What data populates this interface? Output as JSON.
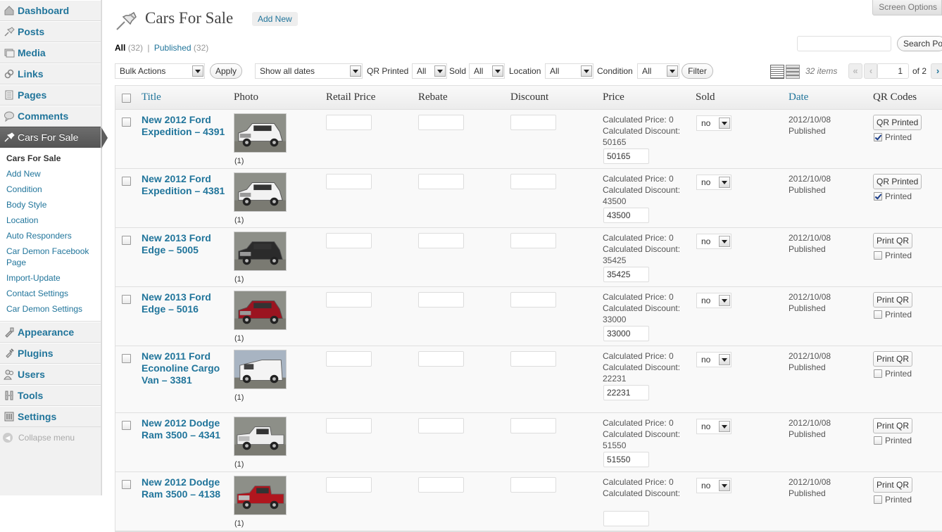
{
  "menu": {
    "items_top": [
      {
        "label": "Dashboard",
        "icon": "dashboard-icon"
      },
      {
        "label": "Posts",
        "icon": "pin-icon"
      },
      {
        "label": "Media",
        "icon": "media-icon"
      },
      {
        "label": "Links",
        "icon": "link-icon"
      },
      {
        "label": "Pages",
        "icon": "pages-icon"
      },
      {
        "label": "Comments",
        "icon": "comment-icon"
      },
      {
        "label": "Cars For Sale",
        "icon": "pin-icon"
      }
    ],
    "submenu": [
      "Cars For Sale",
      "Add New",
      "Condition",
      "Body Style",
      "Location",
      "Auto Responders",
      "Car Demon Facebook Page",
      "Import-Update",
      "Contact Settings",
      "Car Demon Settings"
    ],
    "items_bottom": [
      {
        "label": "Appearance",
        "icon": "appearance-icon"
      },
      {
        "label": "Plugins",
        "icon": "plugin-icon"
      },
      {
        "label": "Users",
        "icon": "users-icon"
      },
      {
        "label": "Tools",
        "icon": "tools-icon"
      },
      {
        "label": "Settings",
        "icon": "settings-icon"
      }
    ],
    "collapse": "Collapse menu"
  },
  "header": {
    "screen_options": "Screen Options",
    "title": "Cars For Sale",
    "add_new": "Add New",
    "search_button": "Search Po"
  },
  "views": {
    "all": "All",
    "all_count": "(32)",
    "sep": "|",
    "published": "Published",
    "published_count": "(32)"
  },
  "filters": {
    "bulk_actions": "Bulk Actions",
    "apply": "Apply",
    "dates": "Show all dates",
    "qr_label": "QR Printed",
    "qr_value": "All",
    "sold_label": "Sold",
    "sold_value": "All",
    "location_label": "Location",
    "location_value": "All",
    "condition_label": "Condition",
    "condition_value": "All",
    "filter": "Filter"
  },
  "pagination": {
    "items": "32 items",
    "first": "«",
    "prev": "‹",
    "current": "1",
    "of": "of 2",
    "next": "›"
  },
  "columns": [
    "Title",
    "Photo",
    "Retail Price",
    "Rebate",
    "Discount",
    "Price",
    "Sold",
    "Date",
    "QR Codes"
  ],
  "rows": [
    {
      "title": "New 2012 Ford Expedition – 4391",
      "count": "(1)",
      "calc_price": "Calculated Price: 0",
      "calc_discount": "Calculated Discount:",
      "discount_val": "50165",
      "price_input": "50165",
      "sold": "no",
      "date": "2012/10/08",
      "status": "Published",
      "qr_button": "QR Printed",
      "printed": "Printed",
      "printed_checked": true,
      "photo": "white-suv"
    },
    {
      "title": "New 2012 Ford Expedition – 4381",
      "count": "(1)",
      "calc_price": "Calculated Price: 0",
      "calc_discount": "Calculated Discount:",
      "discount_val": "43500",
      "price_input": "43500",
      "sold": "no",
      "date": "2012/10/08",
      "status": "Published",
      "qr_button": "QR Printed",
      "printed": "Printed",
      "printed_checked": true,
      "photo": "white-suv"
    },
    {
      "title": "New 2013 Ford Edge – 5005",
      "count": "(1)",
      "calc_price": "Calculated Price: 0",
      "calc_discount": "Calculated Discount:",
      "discount_val": "35425",
      "price_input": "35425",
      "sold": "no",
      "date": "2012/10/08",
      "status": "Published",
      "qr_button": "Print QR",
      "printed": "Printed",
      "printed_checked": false,
      "photo": "black-suv"
    },
    {
      "title": "New 2013 Ford Edge – 5016",
      "count": "(1)",
      "calc_price": "Calculated Price: 0",
      "calc_discount": "Calculated Discount:",
      "discount_val": "33000",
      "price_input": "33000",
      "sold": "no",
      "date": "2012/10/08",
      "status": "Published",
      "qr_button": "Print QR",
      "printed": "Printed",
      "printed_checked": false,
      "photo": "red-suv"
    },
    {
      "title": "New 2011 Ford Econoline Cargo Van – 3381",
      "count": "(1)",
      "calc_price": "Calculated Price: 0",
      "calc_discount": "Calculated Discount:",
      "discount_val": "22231",
      "price_input": "22231",
      "sold": "no",
      "date": "2012/10/08",
      "status": "Published",
      "qr_button": "Print QR",
      "printed": "Printed",
      "printed_checked": false,
      "photo": "white-van"
    },
    {
      "title": "New 2012 Dodge Ram 3500 – 4341",
      "count": "(1)",
      "calc_price": "Calculated Price: 0",
      "calc_discount": "Calculated Discount:",
      "discount_val": "51550",
      "price_input": "51550",
      "sold": "no",
      "date": "2012/10/08",
      "status": "Published",
      "qr_button": "Print QR",
      "printed": "Printed",
      "printed_checked": false,
      "photo": "white-truck"
    },
    {
      "title": "New 2012 Dodge Ram 3500 – 4138",
      "count": "(1)",
      "calc_price": "Calculated Price: 0",
      "calc_discount": "Calculated Discount:",
      "discount_val": "",
      "price_input": "",
      "sold": "no",
      "date": "2012/10/08",
      "status": "Published",
      "qr_button": "Print QR",
      "printed": "Printed",
      "printed_checked": false,
      "photo": "red-truck"
    }
  ],
  "colors": {
    "link": "#21759b",
    "menu_current": "#5d5d5d",
    "border": "#dfdfdf"
  }
}
